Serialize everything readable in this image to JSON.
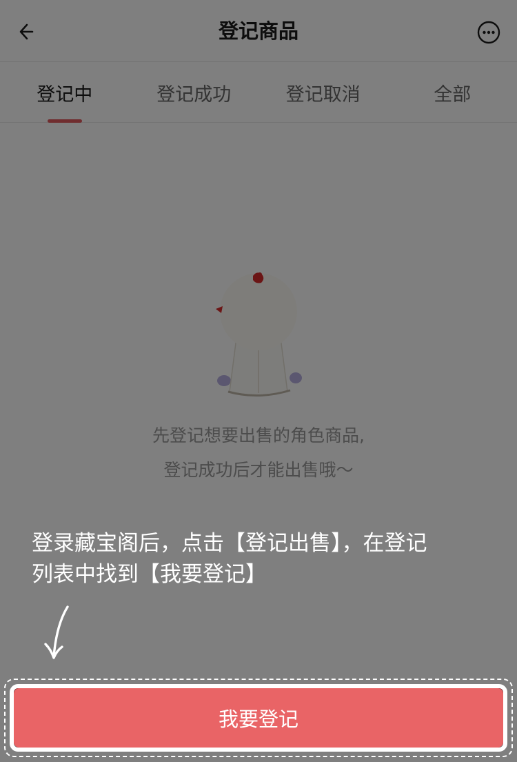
{
  "header": {
    "title": "登记商品",
    "back_icon": "back-arrow-icon",
    "more_icon": "more-dots-icon"
  },
  "tabs": [
    {
      "label": "登记中",
      "active": true
    },
    {
      "label": "登记成功",
      "active": false
    },
    {
      "label": "登记取消",
      "active": false
    },
    {
      "label": "全部",
      "active": false
    }
  ],
  "empty_state": {
    "illustration": "mascot-character",
    "line1": "先登记想要出售的角色商品,",
    "line2": "登记成功后才能出售哦～"
  },
  "guide": {
    "text_line1": "登录藏宝阁后，点击【登记出售】，在登记",
    "text_line2": "列表中找到【我要登记】",
    "arrow_icon": "hand-drawn-down-arrow-icon"
  },
  "primary_button": {
    "label": "我要登记"
  },
  "colors": {
    "accent": "#e05a5e",
    "overlay_button": "#e96466",
    "overlay_dim": "rgba(0,0,0,0.5)"
  }
}
